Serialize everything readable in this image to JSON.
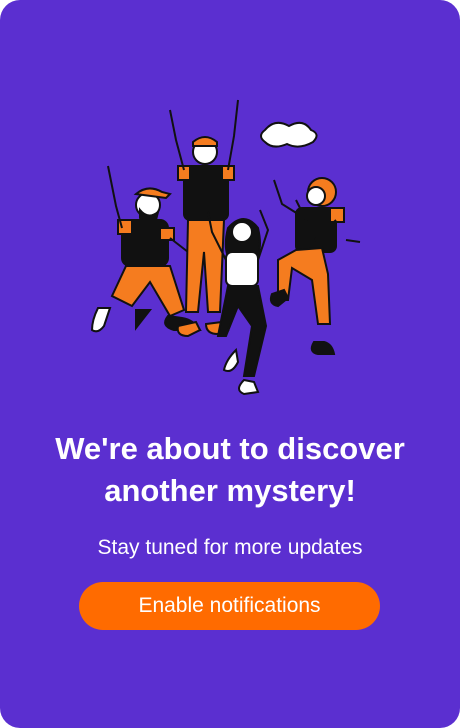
{
  "card": {
    "headline": "We're about to discover another mystery!",
    "subtitle": "Stay tuned for more updates",
    "cta_label": "Enable notifications",
    "illustration": "dancing-people-illustration"
  },
  "colors": {
    "background": "#5b2fd0",
    "button": "#ff6b00",
    "text": "#ffffff",
    "accent_orange": "#f57c1f",
    "figure_black": "#111111"
  }
}
